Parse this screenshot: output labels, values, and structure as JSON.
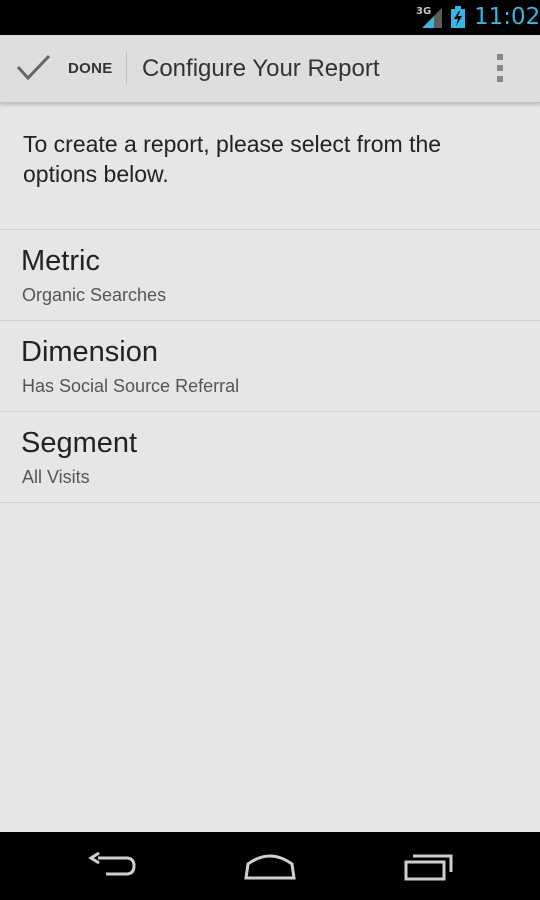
{
  "status_bar": {
    "network": "3G",
    "time": "11:02",
    "signal_icon": "signal-icon",
    "battery_icon": "battery-charging-icon"
  },
  "action_bar": {
    "done_label": "DONE",
    "title": "Configure Your Report",
    "done_icon": "check-icon",
    "menu_icon": "overflow-menu-icon"
  },
  "intro": {
    "text": "To create a report, please select from the options below."
  },
  "options": [
    {
      "label": "Metric",
      "value": "Organic Searches"
    },
    {
      "label": "Dimension",
      "value": "Has Social Source Referral"
    },
    {
      "label": "Segment",
      "value": "All Visits"
    }
  ],
  "nav_bar": {
    "back_icon": "back-icon",
    "home_icon": "home-icon",
    "recents_icon": "recent-apps-icon"
  },
  "colors": {
    "status_time": "#33b5e5",
    "background": "#e6e6e6",
    "action_bar": "#dedede"
  }
}
